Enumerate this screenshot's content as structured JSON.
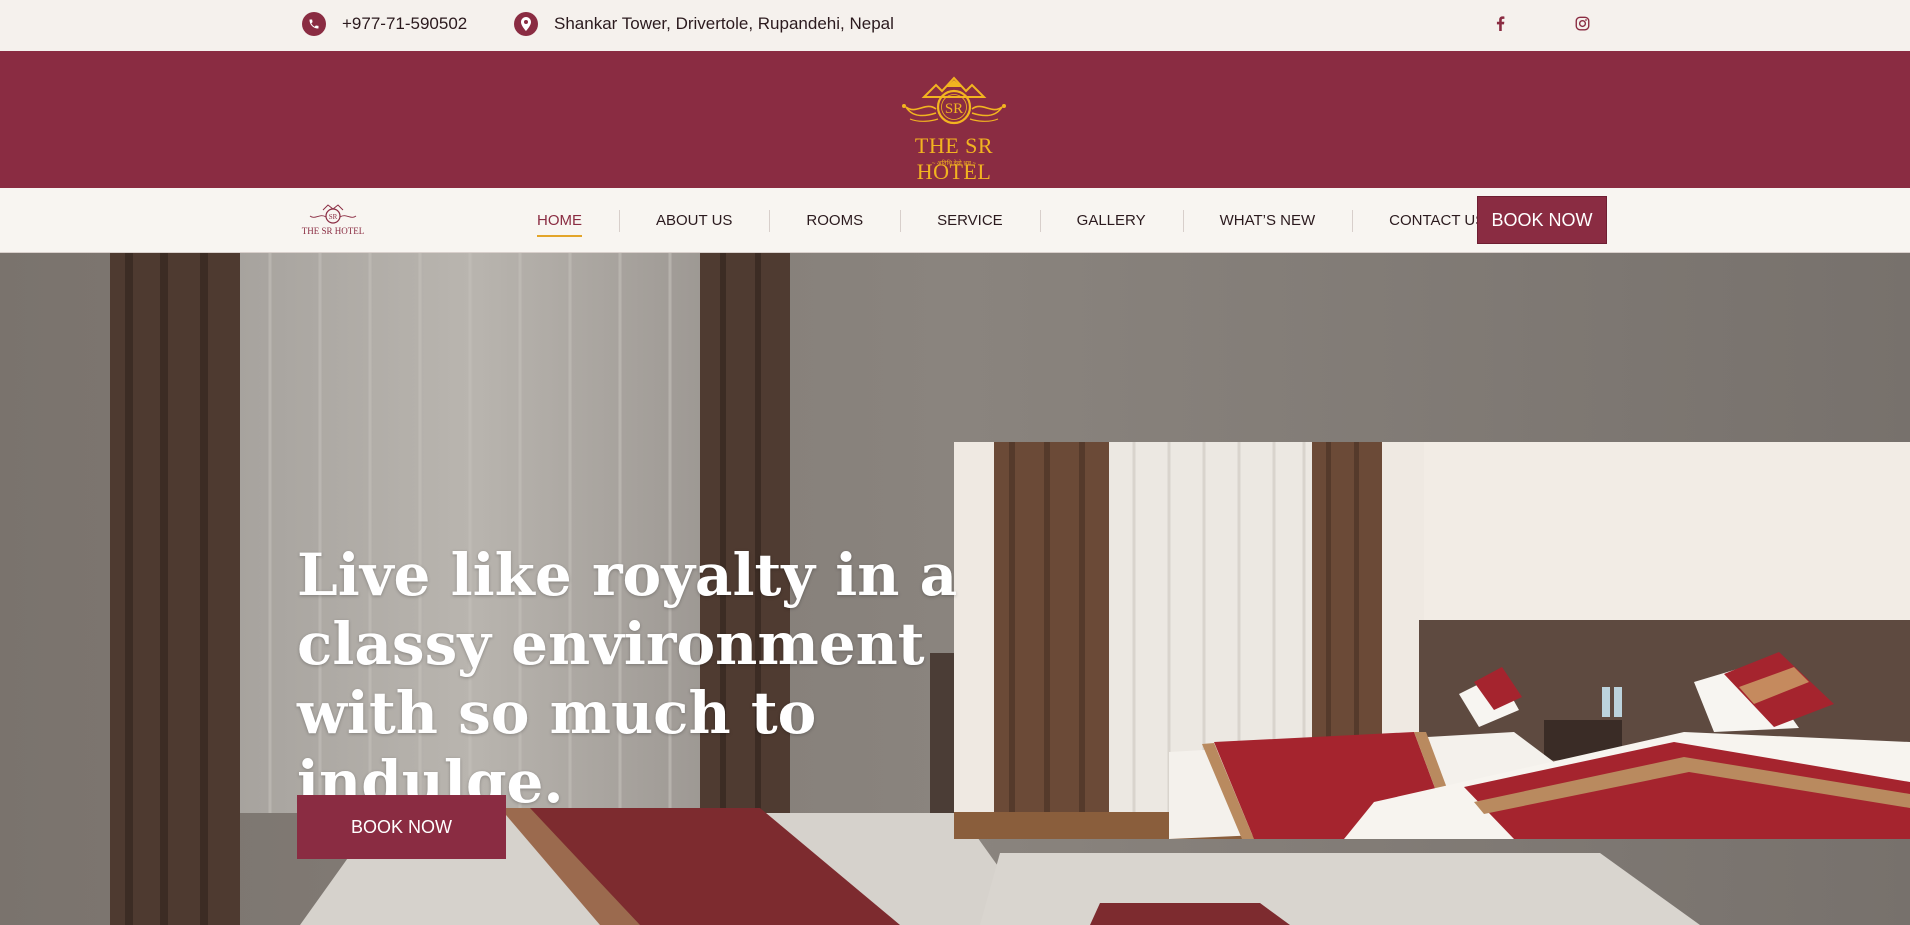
{
  "topbar": {
    "phone": "+977-71-590502",
    "address": "Shankar Tower, Drivertole, Rupandehi, Nepal",
    "phone_icon": "phone-icon",
    "location_icon": "map-pin-icon",
    "social": [
      "facebook-icon",
      "instagram-icon"
    ]
  },
  "brand": {
    "name": "THE SR HOTEL",
    "monogram": "SR",
    "tagline": "~ अतिथि देवो भव ~",
    "nav_logo_name": "THE SR HOTEL"
  },
  "nav": {
    "items": [
      "HOME",
      "ABOUT US",
      "ROOMS",
      "SERVICE",
      "GALLERY",
      "WHAT’S NEW",
      "CONTACT US"
    ],
    "active": "HOME",
    "book_label": "BOOK NOW"
  },
  "hero": {
    "headline": "Live like royalty in a classy environment with so much to indulge.",
    "book_label": "BOOK NOW"
  },
  "colors": {
    "brand": "#8a2c42",
    "gold": "#f2b420",
    "topbar_bg": "#f5f1ed",
    "nav_bg": "#f8f5f1"
  }
}
